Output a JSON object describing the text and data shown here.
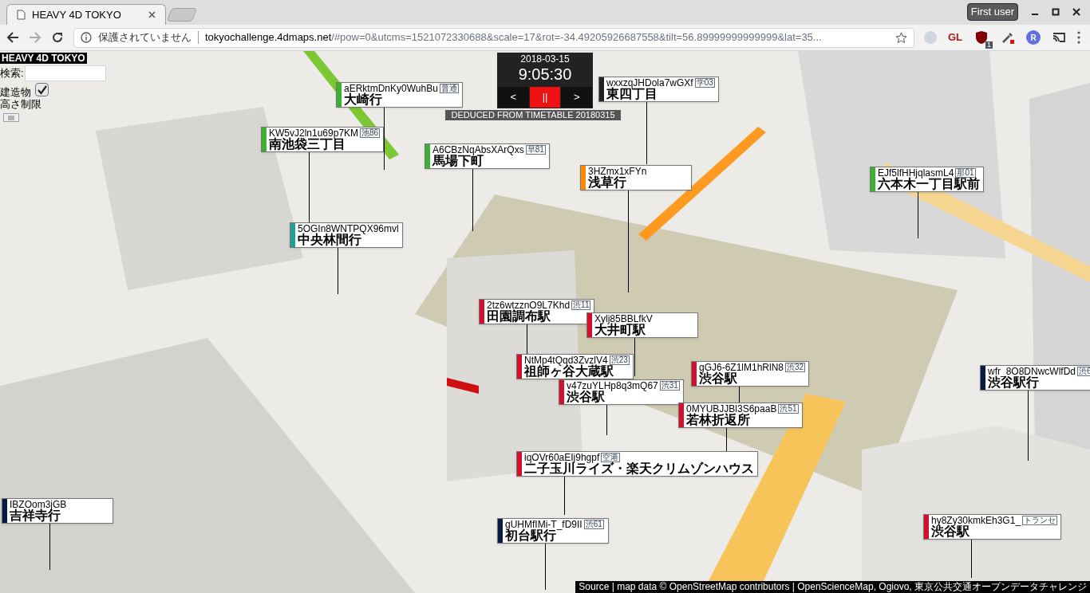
{
  "browser": {
    "tab_title": "HEAVY 4D TOKYO",
    "profile": "First user",
    "security": "保護されていません",
    "url_host": "tokyochallenge.4dmaps.net",
    "url_path": "/#pow=0&utcms=1521072330688&scale=17&rot=-34.49205926687558&tilt=56.89999999999999&lat=35...",
    "extensions": [
      {
        "kind": "dot"
      },
      {
        "kind": "text",
        "label": "GL"
      },
      {
        "kind": "shield",
        "badge": "1"
      },
      {
        "kind": "dropper"
      },
      {
        "kind": "letter",
        "label": "R"
      },
      {
        "kind": "cast"
      }
    ]
  },
  "app": {
    "title": "HEAVY 4D TOKYO",
    "search": {
      "label": "検索:"
    },
    "building_toggle": {
      "lines": [
        "建造物",
        "高さ制限"
      ],
      "checked": true
    }
  },
  "clock": {
    "date": "2018-03-15",
    "time": "9:05:30",
    "buttons": [
      {
        "label": "<",
        "selected": false
      },
      {
        "label": "||",
        "selected": true
      },
      {
        "label": ">",
        "selected": false
      }
    ],
    "source": "DEDUCED FROM TIMETABLE 20180315"
  },
  "vehicles": [
    {
      "code": "aERktmDnKy0WuhBu",
      "route": "普通",
      "destination": "大崎行",
      "color": "#3cb030"
    },
    {
      "code": "wxxzqJHDola7wGXf",
      "route": "学03",
      "destination": "東四丁目",
      "color": "#222222"
    },
    {
      "code": "KW5vJ2ln1u69p7KM",
      "route": "池86",
      "destination": "南池袋三丁目",
      "color": "#3cb030"
    },
    {
      "code": "A6CBzNqAbsXArQxs",
      "route": "早81",
      "destination": "馬場下町",
      "color": "#3cb030"
    },
    {
      "code": "3HZmx1xFYn",
      "destination": "浅草行",
      "color": "#ff8c00"
    },
    {
      "code": "EJf5lfHHjqlasmL4",
      "route": "那01",
      "destination": "六本木一丁目駅前",
      "color": "#3cb030"
    },
    {
      "code": "5OGIn8WNTPQX96mvl",
      "destination": "中央林間行",
      "color": "#20a090"
    },
    {
      "code": "2tz6wtzznO9L7Khd",
      "route": "渋11",
      "destination": "田園調布駅",
      "color": "#d0102c"
    },
    {
      "code": "Xylj85BBLfkV",
      "destination": "大井町駅",
      "color": "#d0102c"
    },
    {
      "code": "NtMp4tQqd3ZvzlV4",
      "route": "渋23",
      "destination": "祖師ヶ谷大蔵駅",
      "color": "#d0102c"
    },
    {
      "code": "gGJ6-6Z1lM1hRlN8",
      "route": "渋32",
      "destination": "渋谷駅",
      "color": "#d0102c"
    },
    {
      "code": "wfr_8O8DNwcWlfDd",
      "route": "渋6",
      "destination": "渋谷駅行",
      "color": "#0b1a44"
    },
    {
      "code": "v47zuYLHp8q3mQ67",
      "route": "渋31",
      "destination": "渋谷駅",
      "color": "#d0102c"
    },
    {
      "code": "0MYUBJJBl3S6paaB",
      "route": "渋51",
      "destination": "若林折返所",
      "color": "#d0102c"
    },
    {
      "code": "iqOVr60aEIj9hgpf",
      "route": "空港",
      "destination": "二子玉川ライズ・楽天クリムゾンハウス",
      "color": "#d0102c"
    },
    {
      "code": "IBZOom3jGB",
      "destination": "吉祥寺行",
      "color": "#0b1a44"
    },
    {
      "code": "gUHMfIMi-T_fD9II",
      "route": "渋61",
      "destination": "初台駅行",
      "color": "#0b1a44"
    },
    {
      "code": "hy8Zy30kmkEh3G1_",
      "route": "トランセ",
      "destination": "渋谷駅",
      "color": "#d0102c"
    }
  ],
  "attribution": "Source | map data © OpenStreetMap contributors | OpenScienceMap, Ogiovo, 東京公共交通オープンデータチャレンジ"
}
